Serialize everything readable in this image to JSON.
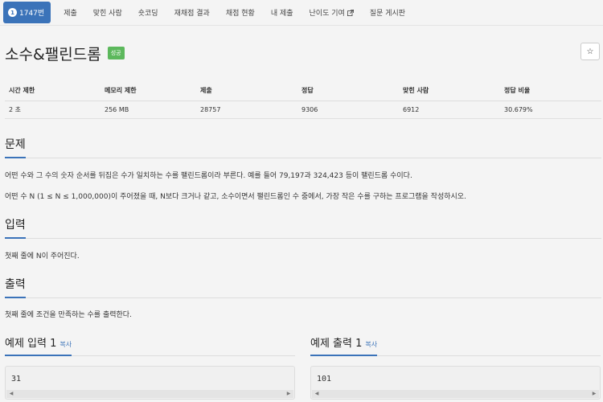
{
  "nav": {
    "tabs": [
      {
        "label": "1747번",
        "badge": "1"
      },
      {
        "label": "제출"
      },
      {
        "label": "맞힌 사람"
      },
      {
        "label": "숏코딩"
      },
      {
        "label": "재채점 결과"
      },
      {
        "label": "채점 현황"
      },
      {
        "label": "내 제출"
      },
      {
        "label": "난이도 기여"
      },
      {
        "label": "질문 게시판"
      }
    ]
  },
  "problem": {
    "title": "소수&팰린드롬",
    "status": "성공",
    "star": "☆"
  },
  "info": {
    "headers": [
      "시간 제한",
      "메모리 제한",
      "제출",
      "정답",
      "맞힌 사람",
      "정답 비율"
    ],
    "values": [
      "2 초",
      "256 MB",
      "28757",
      "9306",
      "6912",
      "30.679%"
    ]
  },
  "sections": {
    "problem_heading": "문제",
    "problem_p1": "어떤 수와 그 수의 숫자 순서를 뒤집은 수가 일치하는 수를 팰린드롬이라 부른다. 예를 들어 79,197과 324,423 등이 팰린드롬 수이다.",
    "problem_p2": "어떤 수 N (1 ≤ N ≤ 1,000,000)이 주어졌을 때, N보다 크거나 같고, 소수이면서 팰린드롬인 수 중에서, 가장 작은 수를 구하는 프로그램을 작성하시오.",
    "input_heading": "입력",
    "input_text": "첫째 줄에 N이 주어진다.",
    "output_heading": "출력",
    "output_text": "첫째 줄에 조건을 만족하는 수를 출력한다."
  },
  "samples": {
    "input_title": "예제 입력 1",
    "output_title": "예제 출력 1",
    "copy_label": "복사",
    "input_value": "31",
    "output_value": "101"
  },
  "colors": {
    "accent": "#3b73b9",
    "success": "#5cb85c"
  }
}
